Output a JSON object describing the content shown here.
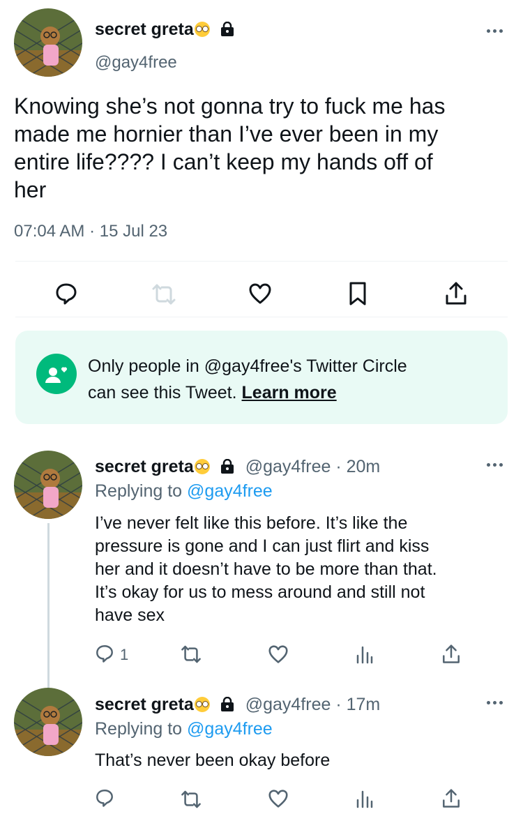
{
  "main_tweet": {
    "author_name": "secret greta",
    "handle": "@gay4free",
    "text_lines": [
      "Knowing she’s not gonna try to fuck me has",
      "made me hornier than I’ve ever been in my",
      "entire life???? I can’t keep my hands off of",
      "her"
    ],
    "timestamp": "07:04 AM · 15 Jul 23"
  },
  "circle_notice": {
    "line1": "Only people in @gay4free's Twitter Circle",
    "line2_prefix": "can see this Tweet.",
    "learn_more": "Learn more"
  },
  "replies": [
    {
      "author_name": "secret greta",
      "handle_time": "@gay4free · 20m",
      "replying_prefix": "Replying to",
      "replying_handle": "@gay4free",
      "text_lines": [
        "I’ve never felt like this before. It’s like the",
        "pressure is gone and I can just flirt and kiss",
        "her and it doesn’t have to be more than that.",
        "It’s okay for us to mess around and still not",
        "have sex"
      ],
      "reply_count": "1"
    },
    {
      "author_name": "secret greta",
      "handle_time": "@gay4free · 17m",
      "replying_prefix": "Replying to",
      "replying_handle": "@gay4free",
      "text_lines": [
        "That’s never been okay before"
      ],
      "reply_count": ""
    }
  ],
  "colors": {
    "accent_blue": "#1d9bf0",
    "secondary_text": "#536471",
    "circle_green": "#00ba7c",
    "circle_bg": "#e9faf5"
  }
}
